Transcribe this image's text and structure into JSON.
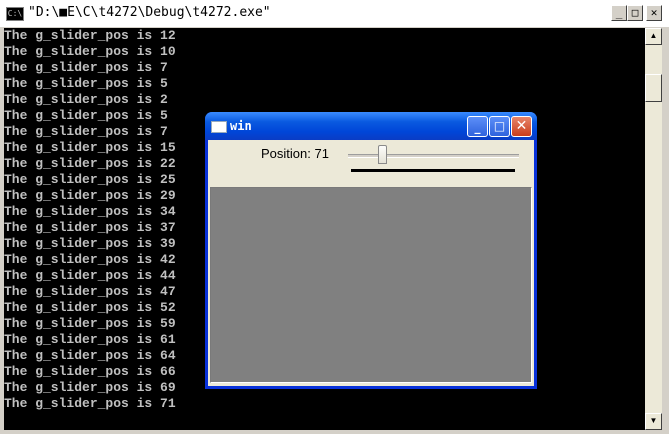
{
  "console": {
    "title": "\"D:\\■E\\C\\t4272\\Debug\\t4272.exe\"",
    "icon": "console-icon",
    "icon_text": "C:\\",
    "buttons": {
      "minimize": "_",
      "maximize": "□",
      "close": "✕"
    },
    "lines": [
      "The g_slider_pos is 12",
      "The g_slider_pos is 10",
      "The g_slider_pos is 7",
      "The g_slider_pos is 5",
      "The g_slider_pos is 2",
      "The g_slider_pos is 5",
      "The g_slider_pos is 7",
      "The g_slider_pos is 15",
      "The g_slider_pos is 22",
      "The g_slider_pos is 25",
      "The g_slider_pos is 29",
      "The g_slider_pos is 34",
      "The g_slider_pos is 37",
      "The g_slider_pos is 39",
      "The g_slider_pos is 42",
      "The g_slider_pos is 44",
      "The g_slider_pos is 47",
      "The g_slider_pos is 52",
      "The g_slider_pos is 59",
      "The g_slider_pos is 61",
      "The g_slider_pos is 64",
      "The g_slider_pos is 66",
      "The g_slider_pos is 69",
      "The g_slider_pos is 71"
    ],
    "scroll_arrows": {
      "up": "▲",
      "down": "▼"
    }
  },
  "win": {
    "title": "win",
    "buttons": {
      "minimize": "_",
      "maximize": "□",
      "close": "✕"
    },
    "trackbar": {
      "label": "Position: 71",
      "value": 71,
      "max": 255
    }
  },
  "colors": {
    "console_bg": "#000000",
    "console_text": "#c0c0c0",
    "xp_title_blue": "#0a5ae0",
    "image_gray": "#808080"
  }
}
